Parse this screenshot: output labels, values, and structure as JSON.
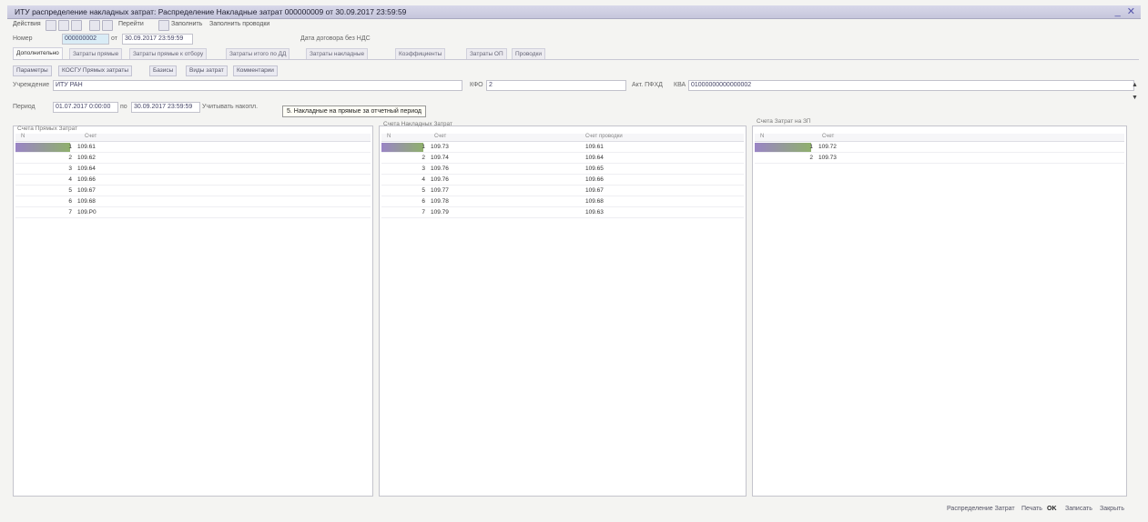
{
  "window": {
    "title": "ИТУ распределение накладных затрат: Распределение Накладные затрат 000000009 от 30.09.2017 23:59:59",
    "controls": "_ ✕"
  },
  "toolbar": {
    "actions": "Действия",
    "goto": "Перейти",
    "help": "Заполнить",
    "fill": "Заполнить проводки"
  },
  "header": {
    "number_label": "Номер",
    "number_value": "000000002",
    "from_label": "от",
    "date_value": "30.09.2017 23:59:59",
    "vat_label": "Дата договора без НДС"
  },
  "tabs": [
    {
      "label": "Дополнительно",
      "active": true
    },
    {
      "label": "Затраты прямые"
    },
    {
      "label": "Затраты прямые к отбору"
    },
    {
      "label": "Затраты итого по ДД"
    },
    {
      "label": "Затраты накладные"
    },
    {
      "label": "Коэффициенты"
    },
    {
      "label": "Затраты ОП"
    },
    {
      "label": "Проводки"
    }
  ],
  "subtabs": [
    {
      "label": "Параметры"
    },
    {
      "label": "КОСГУ Прямых затраты"
    },
    {
      "label": "Базисы"
    },
    {
      "label": "Виды затрат"
    },
    {
      "label": "Комментарии"
    }
  ],
  "params": {
    "institution_label": "Учреждение",
    "institution_value": "ИТУ РАН",
    "kfo_label": "КФО",
    "kfo_value": "2",
    "act_label": "Акт. ПФХД",
    "kva_label": "КВА",
    "kva_value": "01000000000000002"
  },
  "period": {
    "label": "Период",
    "from": "01.07.2017 0:00:00",
    "to_label": "по",
    "to": "30.09.2017 23:59:59",
    "after": "Учитывать накопл."
  },
  "tooltip": "5. Накладные на прямые за отчетный период",
  "panels": [
    {
      "title": "Счета Прямых Затрат",
      "col_n": "N",
      "col_account": "Счет",
      "rows": [
        {
          "n": "1",
          "account": "109.61"
        },
        {
          "n": "2",
          "account": "109.62"
        },
        {
          "n": "3",
          "account": "109.64"
        },
        {
          "n": "4",
          "account": "109.66"
        },
        {
          "n": "5",
          "account": "109.67"
        },
        {
          "n": "6",
          "account": "109.68"
        },
        {
          "n": "7",
          "account": "109.P0"
        }
      ]
    },
    {
      "title": "Счета Накладных Затрат",
      "col_n": "N",
      "col_account": "Счет",
      "col_post": "Счет проводки",
      "rows": [
        {
          "n": "1",
          "account": "109.73",
          "post": "109.61"
        },
        {
          "n": "2",
          "account": "109.74",
          "post": "109.64"
        },
        {
          "n": "3",
          "account": "109.76",
          "post": "109.65"
        },
        {
          "n": "4",
          "account": "109.76",
          "post": "109.66"
        },
        {
          "n": "5",
          "account": "109.77",
          "post": "109.67"
        },
        {
          "n": "6",
          "account": "109.78",
          "post": "109.68"
        },
        {
          "n": "7",
          "account": "109.79",
          "post": "109.63"
        }
      ]
    },
    {
      "title": "Счета Затрат на ЗП",
      "col_n": "N",
      "col_account": "Счет",
      "rows": [
        {
          "n": "1",
          "account": "109.72"
        },
        {
          "n": "2",
          "account": "109.73"
        }
      ]
    }
  ],
  "statusbar": {
    "distribute": "Распределение Затрат",
    "print": "Печать",
    "ok": "OK",
    "save": "Записать",
    "close": "Закрыть"
  }
}
